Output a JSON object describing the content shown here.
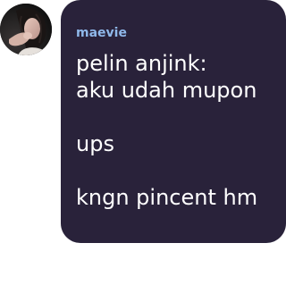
{
  "message": {
    "sender": "maevie",
    "lines": [
      "pelin anjink:",
      "aku udah mupon",
      "",
      "ups",
      "",
      "kngn pincent hm"
    ]
  },
  "avatar": {
    "icon": "user-photo-avatar"
  },
  "colors": {
    "bubble_background": "#29223a",
    "sender_name": "#8fb8ea",
    "message_text": "#ffffff",
    "page_background": "#ffffff"
  }
}
